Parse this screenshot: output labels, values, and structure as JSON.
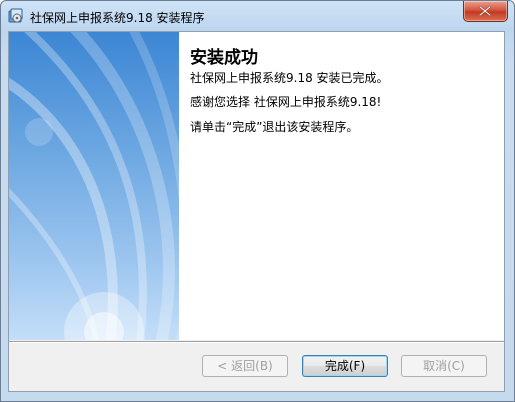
{
  "window": {
    "title": "社保网上申报系统9.18 安装程序"
  },
  "content": {
    "heading": "安装成功",
    "line1": "社保网上申报系统9.18  安装已完成。",
    "line2": "感谢您选择 社保网上申报系统9.18!",
    "line3": "请单击“完成”退出该安装程序。"
  },
  "buttons": {
    "back": "< 返回(B)",
    "finish": "完成(F)",
    "cancel": "取消(C)"
  },
  "icons": {
    "app": "installer-icon",
    "close": "close-icon"
  }
}
